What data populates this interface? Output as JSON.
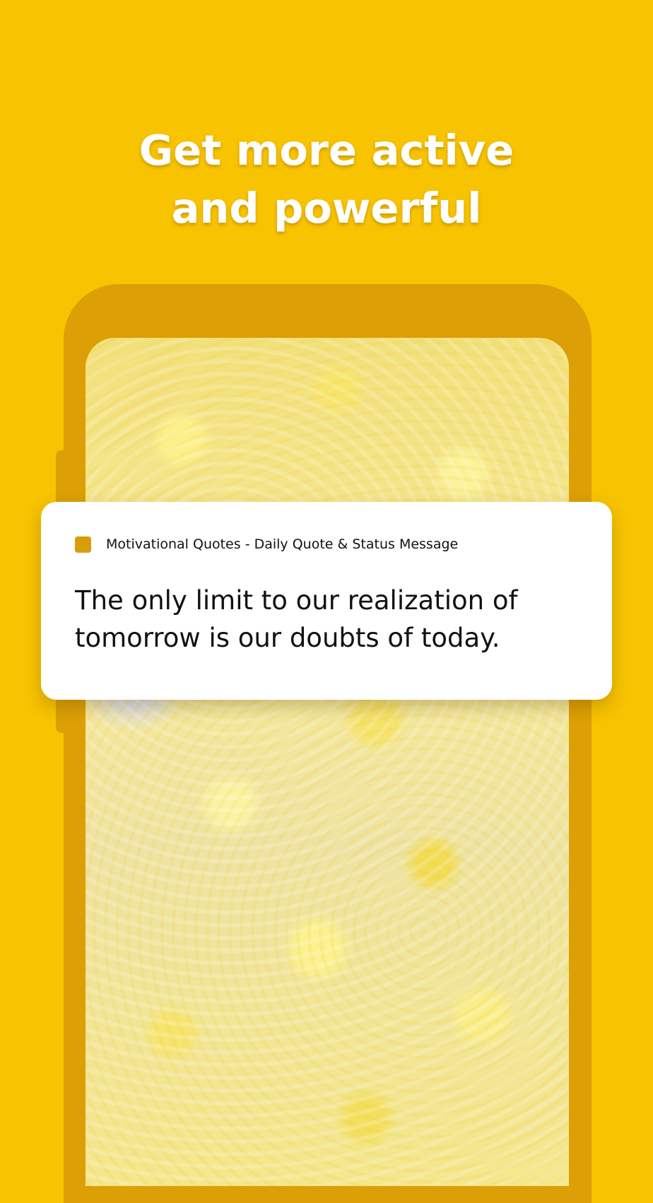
{
  "headline": {
    "line1": "Get more active",
    "line2": "and powerful"
  },
  "notification": {
    "app_icon": "app-square-icon",
    "app_name": "Motivational Quotes - Daily Quote & Status Message",
    "quote": "The only limit to our realization of tomorrow is our doubts of today."
  },
  "colors": {
    "background": "#F8C300",
    "phone_frame": "#DC9F05",
    "app_icon": "#D79E07",
    "card": "#FFFFFF",
    "text": "#111111"
  }
}
